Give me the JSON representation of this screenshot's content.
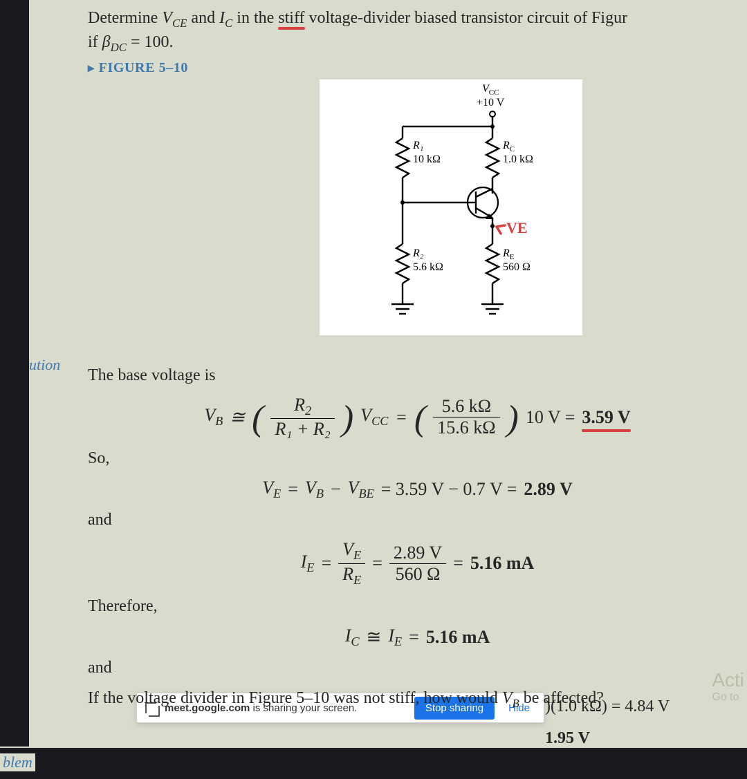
{
  "problem": {
    "line1_prefix": "Determine ",
    "line1_vce": "V",
    "line1_vce_sub": "CE",
    "line1_mid": " and ",
    "line1_ic_i": "I",
    "line1_ic_sub": "C",
    "line1_in": " in the ",
    "line1_stiff": "stiff",
    "line1_rest": " voltage-divider biased transistor circuit of Figur",
    "line2_prefix": "if ",
    "line2_beta": "β",
    "line2_beta_sub": "DC",
    "line2_eq": " = 100."
  },
  "figure_label": "FIGURE 5–10",
  "circuit": {
    "vcc_label": "V",
    "vcc_sub": "CC",
    "vcc_val": "+10 V",
    "r1": "R₁",
    "r1_val": "10 kΩ",
    "rc": "R",
    "rc_sub": "C",
    "rc_val": "1.0 kΩ",
    "r2": "R₂",
    "r2_val": "5.6 kΩ",
    "re": "R",
    "re_sub": "E",
    "re_val": "560 Ω",
    "ve_hand": "VE"
  },
  "margin": {
    "solution": "ution",
    "problem": "blem"
  },
  "solution": {
    "intro": "The base voltage is",
    "eq1": {
      "lhs_v": "V",
      "lhs_sub": "B",
      "approx": "≅",
      "frac1_num_r": "R",
      "frac1_num_sub": "2",
      "frac1_den": "R₁ + R₂",
      "vcc_v": "V",
      "vcc_sub": "CC",
      "eq": "=",
      "frac2_num": "5.6 kΩ",
      "frac2_den": "15.6 kΩ",
      "tail": "10 V = ",
      "result": "3.59 V"
    },
    "so": "So,",
    "eq2": "V_E = V_B − V_BE = 3.59 V − 0.7 V = 2.89 V",
    "eq2_parts": {
      "ve": "V",
      "ve_s": "E",
      "eq": " = ",
      "vb": "V",
      "vb_s": "B",
      "minus": " − ",
      "vbe": "V",
      "vbe_s": "BE",
      "mid": " = 3.59 V − 0.7 V = ",
      "res": "2.89 V"
    },
    "and1": "and",
    "eq3": {
      "ie": "I",
      "ie_s": "E",
      "eq": " = ",
      "f_num_v": "V",
      "f_num_s": "E",
      "f_den_r": "R",
      "f_den_s": "E",
      "eq2": " = ",
      "f2_num": "2.89 V",
      "f2_den": "560 Ω",
      "tail": " = ",
      "res": "5.16 mA"
    },
    "therefore": "Therefore,",
    "eq4": {
      "ic": "I",
      "ic_s": "C",
      "approx": " ≅ ",
      "ie": "I",
      "ie_s": "E",
      "eq": " = ",
      "res": "5.16 mA"
    },
    "and2": "and",
    "trail_line1": ")(1.0 kΩ) = 4.84 V",
    "trail_line2": "1.95 V"
  },
  "ghost": {
    "l1": "Acti",
    "l2": "Go to"
  },
  "share": {
    "domain": "meet.google.com",
    "tail": " is sharing your screen.",
    "stop": "Stop sharing",
    "hide": "Hide"
  },
  "related": "If the voltage divider in Figure 5–10 was not stiff, how would V_B be affected?",
  "related_parts": {
    "pre": "If the voltage divider in Figure 5–10 was not stiff, how would ",
    "v": "V",
    "sub": "B",
    "post": " be affected?"
  }
}
